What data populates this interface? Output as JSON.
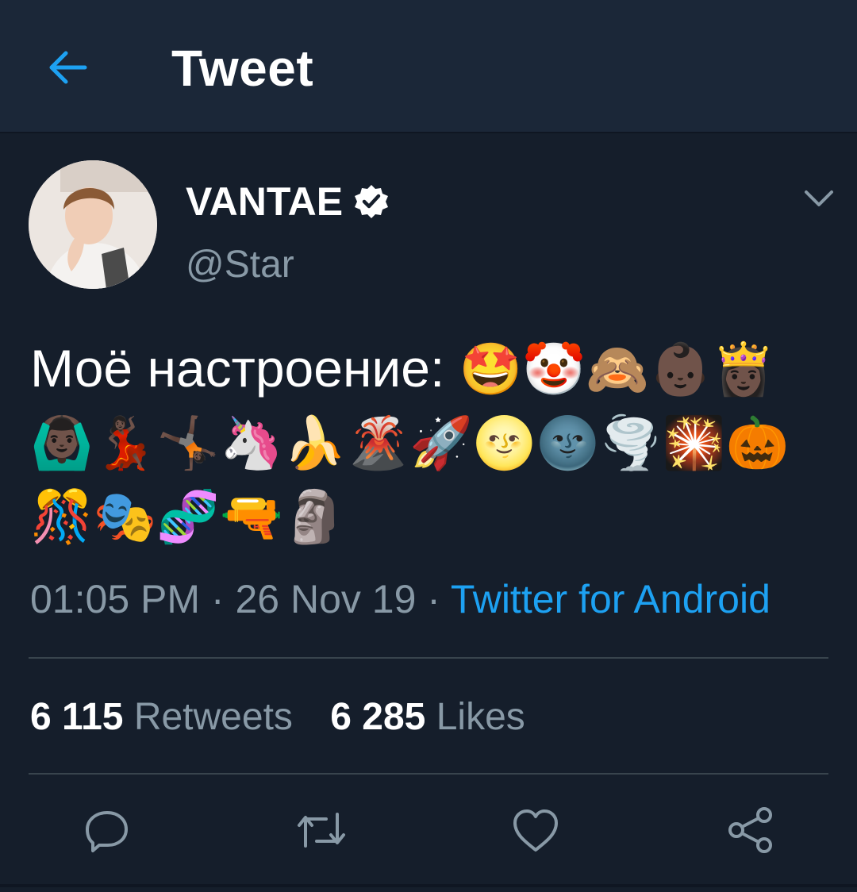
{
  "header": {
    "title": "Tweet"
  },
  "tweet": {
    "author_name": "VANTAE",
    "handle": "@Star",
    "text": "Моё настроение:",
    "emojis": "🤩🤡🙈👶🏿👸🏿🙆🏿‍♂️💃🏿🤸🏿🦄🍌🌋🚀🌝🌚🌪️🎇🎃🎊🎭🧬🔫🗿",
    "time": "01:05 PM",
    "date": "26 Nov 19",
    "separator": " · ",
    "source": "Twitter for Android",
    "retweets_count": "6 115",
    "retweets_label": "Retweets",
    "likes_count": "6 285",
    "likes_label": "Likes"
  },
  "colors": {
    "background": "#151e2b",
    "header": "#1b2738",
    "accent": "#1da1f2",
    "secondary_text": "#8899a6"
  },
  "icons": {
    "back": "arrow-left-icon",
    "verified": "verified-badge-icon",
    "caret": "chevron-down-icon",
    "reply": "reply-icon",
    "retweet": "retweet-icon",
    "like": "heart-icon",
    "share": "share-icon"
  }
}
